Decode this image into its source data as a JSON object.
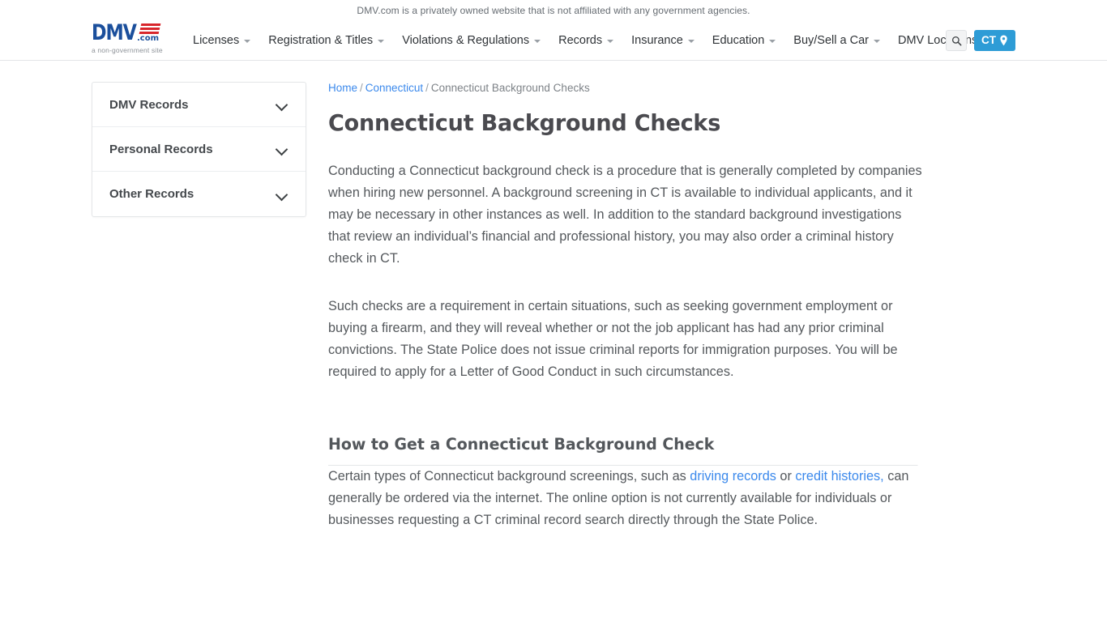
{
  "disclaimer": {
    "text": "DMV.com is a privately owned website that is not affiliated with any government agencies."
  },
  "header": {
    "logo": {
      "wordmark": "DMV",
      "dotcom": ".com",
      "tagline": "a non-government site",
      "blue": "#1b4f9c",
      "red": "#d8262c"
    },
    "nav": [
      {
        "label": "Licenses",
        "has_dropdown": true
      },
      {
        "label": "Registration & Titles",
        "has_dropdown": true
      },
      {
        "label": "Violations & Regulations",
        "has_dropdown": true
      },
      {
        "label": "Records",
        "has_dropdown": true
      },
      {
        "label": "Insurance",
        "has_dropdown": true
      },
      {
        "label": "Education",
        "has_dropdown": true
      },
      {
        "label": "Buy/Sell a Car",
        "has_dropdown": true
      },
      {
        "label": "DMV Locations",
        "has_dropdown": false
      }
    ],
    "search_icon": "search-icon",
    "state_selector": {
      "label": "CT",
      "icon": "location-pin-icon",
      "color": "#2e9cd6"
    }
  },
  "sidebar": {
    "items": [
      {
        "label": "DMV Records",
        "icon": "chevron-down-icon"
      },
      {
        "label": "Personal Records",
        "icon": "chevron-down-icon"
      },
      {
        "label": "Other Records",
        "icon": "chevron-down-icon"
      }
    ]
  },
  "breadcrumb": {
    "home": "Home",
    "state": "Connecticut",
    "current": "Connecticut Background Checks",
    "separator": "/"
  },
  "main": {
    "title": "Connecticut Background Checks",
    "paragraph_1": "Conducting a Connecticut background check is a procedure that is generally completed by companies when hiring new personnel. A background screening in CT is available to individual applicants, and it may be necessary in other instances as well. In addition to the standard background investigations that review an individual’s financial and professional history, you may also order a criminal history check in CT.",
    "paragraph_2": "Such checks are a requirement in certain situations, such as seeking government employment or buying a firearm, and they will reveal whether or not the job applicant has had any prior criminal convictions. The State Police does not issue criminal reports for immigration purposes. You will be required to apply for a Letter of Good Conduct in such circumstances.",
    "section_title": "How to Get a Connecticut Background Check",
    "paragraph_3": {
      "part_1": "Certain types of Connecticut background screenings, such as ",
      "link_1": "driving records",
      "part_2": " or ",
      "link_2": "credit histories,",
      "part_3": " can generally be ordered via the internet. The online option is not currently available for individuals or businesses requesting a CT criminal record search directly through the State Police."
    }
  }
}
